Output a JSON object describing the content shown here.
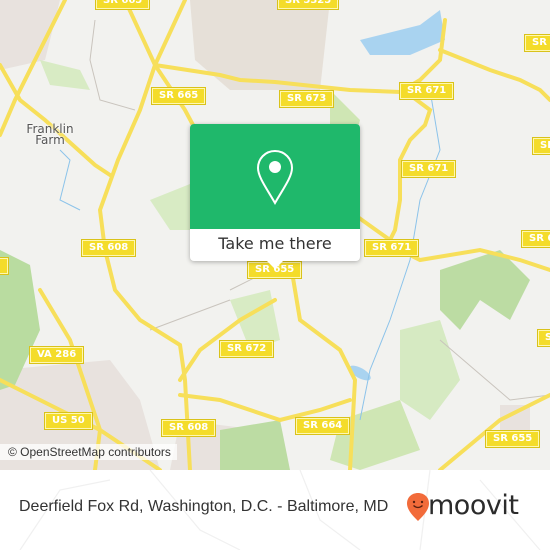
{
  "map": {
    "place_labels": [
      {
        "name": "franklin-farm",
        "text": "Franklin\nFarm"
      }
    ],
    "road_labels": [
      {
        "id": "sr665-top",
        "text": "SR 665"
      },
      {
        "id": "sr5325",
        "text": "SR 5325"
      },
      {
        "id": "sr665",
        "text": "SR 665"
      },
      {
        "id": "sr673",
        "text": "SR 673"
      },
      {
        "id": "sr671-a",
        "text": "SR 671"
      },
      {
        "id": "sr671-b",
        "text": "SR 671"
      },
      {
        "id": "sr671-c",
        "text": "SR 671"
      },
      {
        "id": "sr608-a",
        "text": "SR 608"
      },
      {
        "id": "sr655-mid",
        "text": "SR 655"
      },
      {
        "id": "va286",
        "text": "VA 286"
      },
      {
        "id": "sr672",
        "text": "SR 672"
      },
      {
        "id": "us50",
        "text": "US 50"
      },
      {
        "id": "sr608-b",
        "text": "SR 608"
      },
      {
        "id": "sr664",
        "text": "SR 664"
      },
      {
        "id": "sr655-br",
        "text": "SR 655"
      },
      {
        "id": "sr-right-1",
        "text": "SR"
      },
      {
        "id": "sr-right-2",
        "text": "SR"
      },
      {
        "id": "sr-right-3",
        "text": "SR 6"
      },
      {
        "id": "sr-right-4",
        "text": "S"
      },
      {
        "id": "sr-left-edge",
        "text": ""
      }
    ],
    "attribution": "© OpenStreetMap contributors",
    "colors": {
      "background": "#f2f2ef",
      "road": "#f7df5a",
      "park": "#cfe6b4",
      "water": "#a9d3f0",
      "urban": "#e8e2de"
    }
  },
  "popup": {
    "icon": "map-pin-icon",
    "action_label": "Take me there",
    "accent_color": "#1fb86b"
  },
  "footer": {
    "address": "Deerfield Fox Rd, Washington, D.C. - Baltimore, MD",
    "brand_name": "moovit",
    "brand_color": "#f26b3a"
  }
}
